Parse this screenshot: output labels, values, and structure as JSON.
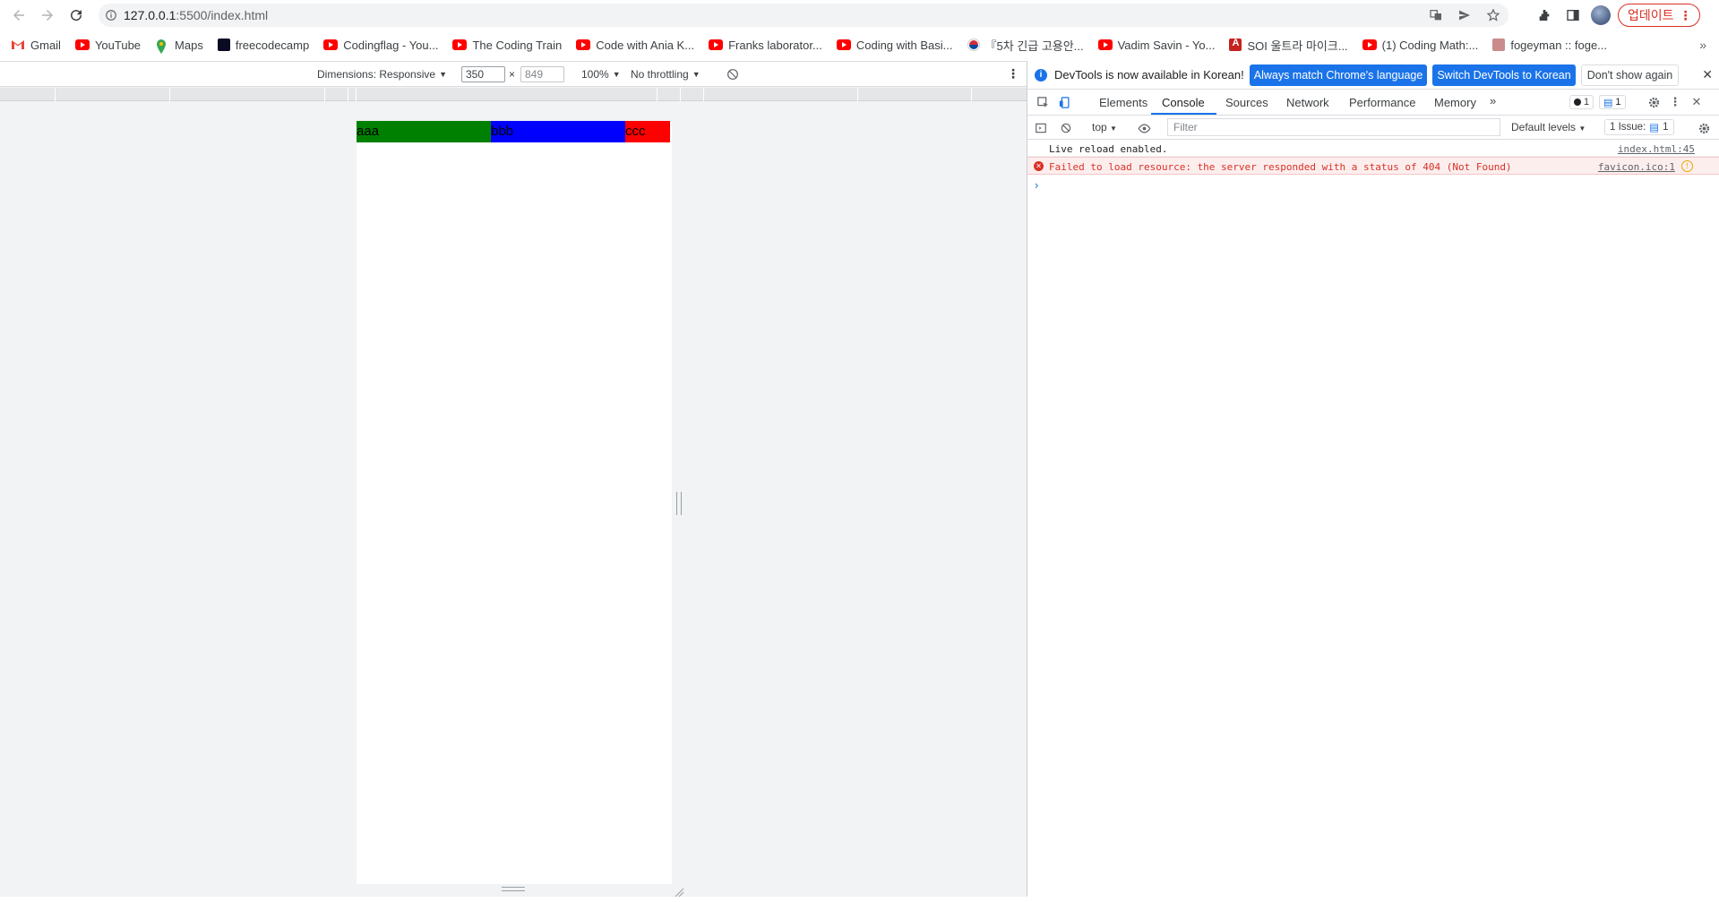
{
  "browser": {
    "url_host": "127.0.0.1",
    "url_rest": ":5500/index.html",
    "update_label": "업데이트"
  },
  "bookmarks": [
    {
      "label": "Gmail",
      "icon": "gmail-icon"
    },
    {
      "label": "YouTube",
      "icon": "youtube-icon"
    },
    {
      "label": "Maps",
      "icon": "maps-icon"
    },
    {
      "label": "freecodecamp",
      "icon": "freecodecamp-icon"
    },
    {
      "label": "Codingflag - You...",
      "icon": "youtube-icon"
    },
    {
      "label": "The Coding Train",
      "icon": "youtube-icon"
    },
    {
      "label": "Code with Ania K...",
      "icon": "youtube-icon"
    },
    {
      "label": "Franks laborator...",
      "icon": "youtube-icon"
    },
    {
      "label": "Coding with Basi...",
      "icon": "youtube-icon"
    },
    {
      "label": "『5차 긴급 고용안...",
      "icon": "korea-flag-icon"
    },
    {
      "label": "Vadim Savin - Yo...",
      "icon": "youtube-icon"
    },
    {
      "label": "SOI 울트라 마이크...",
      "icon": "soi-icon"
    },
    {
      "label": "(1) Coding Math:...",
      "icon": "youtube-icon"
    },
    {
      "label": "fogeyman :: foge...",
      "icon": "fogeyman-icon"
    }
  ],
  "device_toolbar": {
    "dimensions_label": "Dimensions: Responsive",
    "width": "350",
    "height": "849",
    "zoom": "100%",
    "throttling": "No throttling"
  },
  "page": {
    "bars": [
      {
        "label": "aaa",
        "color": "#008000"
      },
      {
        "label": "bbb",
        "color": "#0000ff"
      },
      {
        "label": "ccc",
        "color": "#ff0000"
      }
    ]
  },
  "devtools": {
    "infobar_text": "DevTools is now available in Korean!",
    "btn_match": "Always match Chrome's language",
    "btn_switch": "Switch DevTools to Korean",
    "btn_dont_show": "Don't show again",
    "tabs": [
      "Elements",
      "Console",
      "Sources",
      "Network",
      "Performance",
      "Memory"
    ],
    "active_tab": "Console",
    "error_count": "1",
    "message_count": "1",
    "context": "top",
    "filter_placeholder": "Filter",
    "levels": "Default levels",
    "issues_label": "1 Issue:",
    "issues_count": "1",
    "messages": [
      {
        "text": "Live reload enabled.",
        "source": "index.html:45",
        "level": "info"
      },
      {
        "text": "Failed to load resource: the server responded with a status of 404 (Not Found)",
        "source": "favicon.ico:1",
        "level": "error"
      }
    ]
  }
}
